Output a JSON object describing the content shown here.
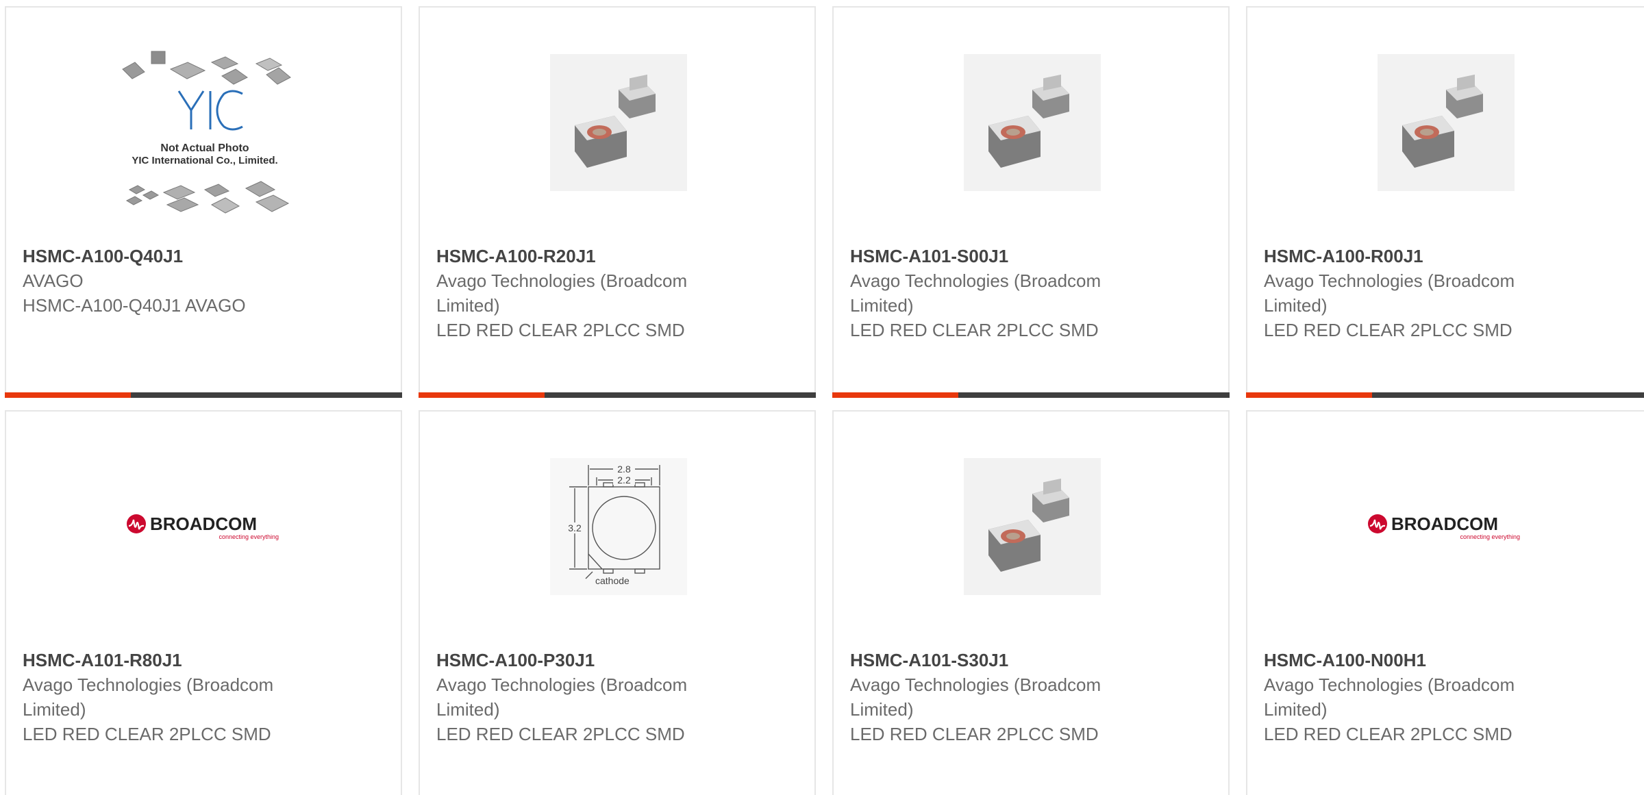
{
  "products": [
    {
      "part_number": "HSMC-A100-Q40J1",
      "manufacturer": "AVAGO",
      "description": "HSMC-A100-Q40J1 AVAGO",
      "image_type": "yic-placeholder",
      "image_text_logo": "YIC",
      "image_text_line1": "Not Actual Photo",
      "image_text_line2": "YIC International Co., Limited."
    },
    {
      "part_number": "HSMC-A100-R20J1",
      "manufacturer": "Avago Technologies (Broadcom Limited)",
      "description": "LED RED CLEAR 2PLCC SMD",
      "image_type": "led-photo"
    },
    {
      "part_number": "HSMC-A101-S00J1",
      "manufacturer": "Avago Technologies (Broadcom Limited)",
      "description": "LED RED CLEAR 2PLCC SMD",
      "image_type": "led-photo"
    },
    {
      "part_number": "HSMC-A100-R00J1",
      "manufacturer": "Avago Technologies (Broadcom Limited)",
      "description": "LED RED CLEAR 2PLCC SMD",
      "image_type": "led-photo"
    },
    {
      "part_number": "HSMC-A101-R80J1",
      "manufacturer": "Avago Technologies (Broadcom Limited)",
      "description": "LED RED CLEAR 2PLCC SMD",
      "image_type": "broadcom-logo",
      "logo_text": "BROADCOM",
      "logo_tagline": "connecting everything"
    },
    {
      "part_number": "HSMC-A100-P30J1",
      "manufacturer": "Avago Technologies (Broadcom Limited)",
      "description": "LED RED CLEAR 2PLCC SMD",
      "image_type": "dimension-drawing",
      "dim_top": "2.8",
      "dim_inner": "2.2",
      "dim_side": "3.2",
      "dim_label": "cathode"
    },
    {
      "part_number": "HSMC-A101-S30J1",
      "manufacturer": "Avago Technologies (Broadcom Limited)",
      "description": "LED RED CLEAR 2PLCC SMD",
      "image_type": "led-photo"
    },
    {
      "part_number": "HSMC-A100-N00H1",
      "manufacturer": "Avago Technologies (Broadcom Limited)",
      "description": "LED RED CLEAR 2PLCC SMD",
      "image_type": "broadcom-logo",
      "logo_text": "BROADCOM",
      "logo_tagline": "connecting everything"
    }
  ],
  "colors": {
    "accent": "#e8380d",
    "bar": "#3f3f3f",
    "border": "#e6e6e6",
    "broadcom_red": "#cc092f"
  }
}
